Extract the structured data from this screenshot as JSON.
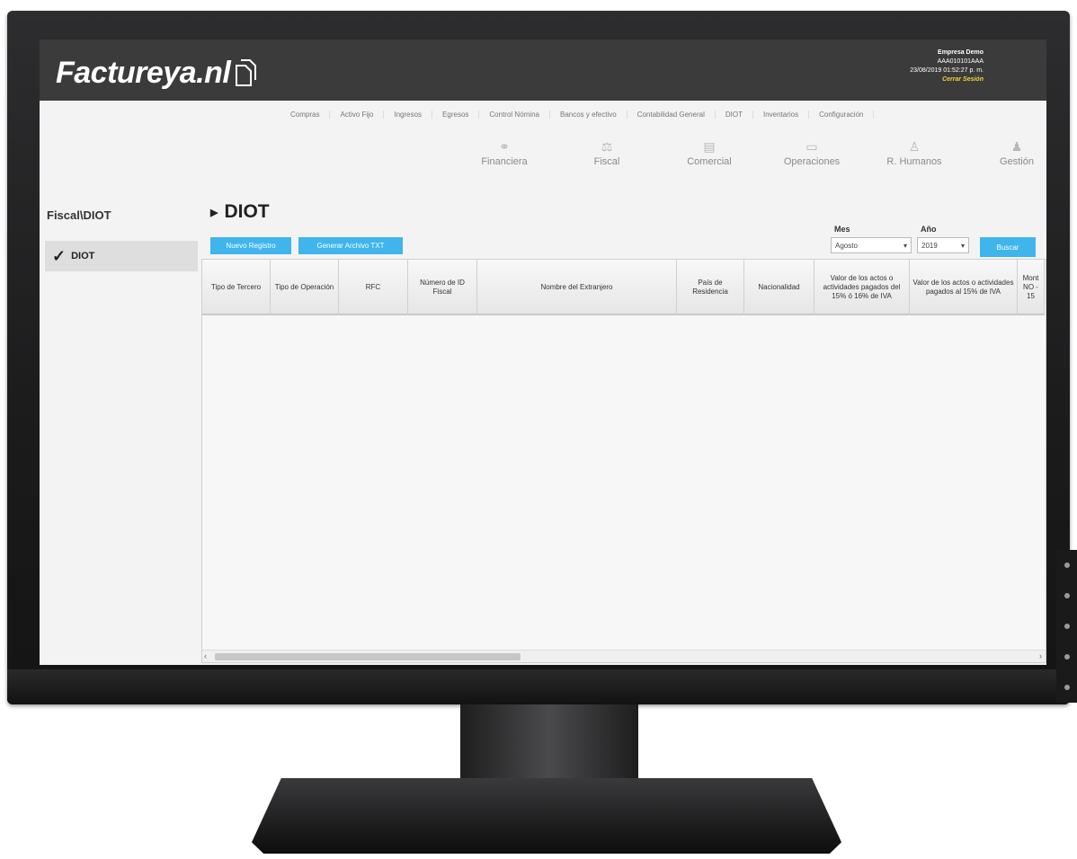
{
  "brand": {
    "name": "Factureya.nl"
  },
  "user": {
    "company": "Empresa Demo",
    "rfc": "AAA010101AAA",
    "datetime": "23/08/2019 01:52:27 p. m.",
    "logout": "Cerrar Sesión"
  },
  "menu": [
    "Compras",
    "Activo Fijo",
    "Ingresos",
    "Egresos",
    "Control Nómina",
    "Bancos y efectivo",
    "Contabilidad General",
    "DIOT",
    "Inventarios",
    "Configuración"
  ],
  "modules": [
    {
      "label": "Financiera",
      "icon": "link-icon"
    },
    {
      "label": "Fiscal",
      "icon": "scale-icon"
    },
    {
      "label": "Comercial",
      "icon": "building-icon"
    },
    {
      "label": "Operaciones",
      "icon": "monitor-icon"
    },
    {
      "label": "R. Humanos",
      "icon": "person-icon"
    },
    {
      "label": "Gestión",
      "icon": "org-icon"
    }
  ],
  "breadcrumb": "Fiscal\\DIOT",
  "sidebar": {
    "item": "DIOT"
  },
  "page": {
    "title": "DIOT"
  },
  "buttons": {
    "new": "Nuevo Registro",
    "txt": "Generar Archivo TXT",
    "search": "Buscar"
  },
  "filters": {
    "mes_label": "Mes",
    "mes_value": "Agosto",
    "anio_label": "Año",
    "anio_value": "2019"
  },
  "table": {
    "columns": [
      "Tipo de Tercero",
      "Tipo de Operación",
      "RFC",
      "Número de ID Fiscal",
      "Nombre del Extranjero",
      "País de Residencia",
      "Nacionalidad",
      "Valor de los actos o actividades pagados del 15% ó 16% de IVA",
      "Valor de los actos o actividades pagados al 15% de IVA",
      "Mont NO - 15"
    ]
  }
}
